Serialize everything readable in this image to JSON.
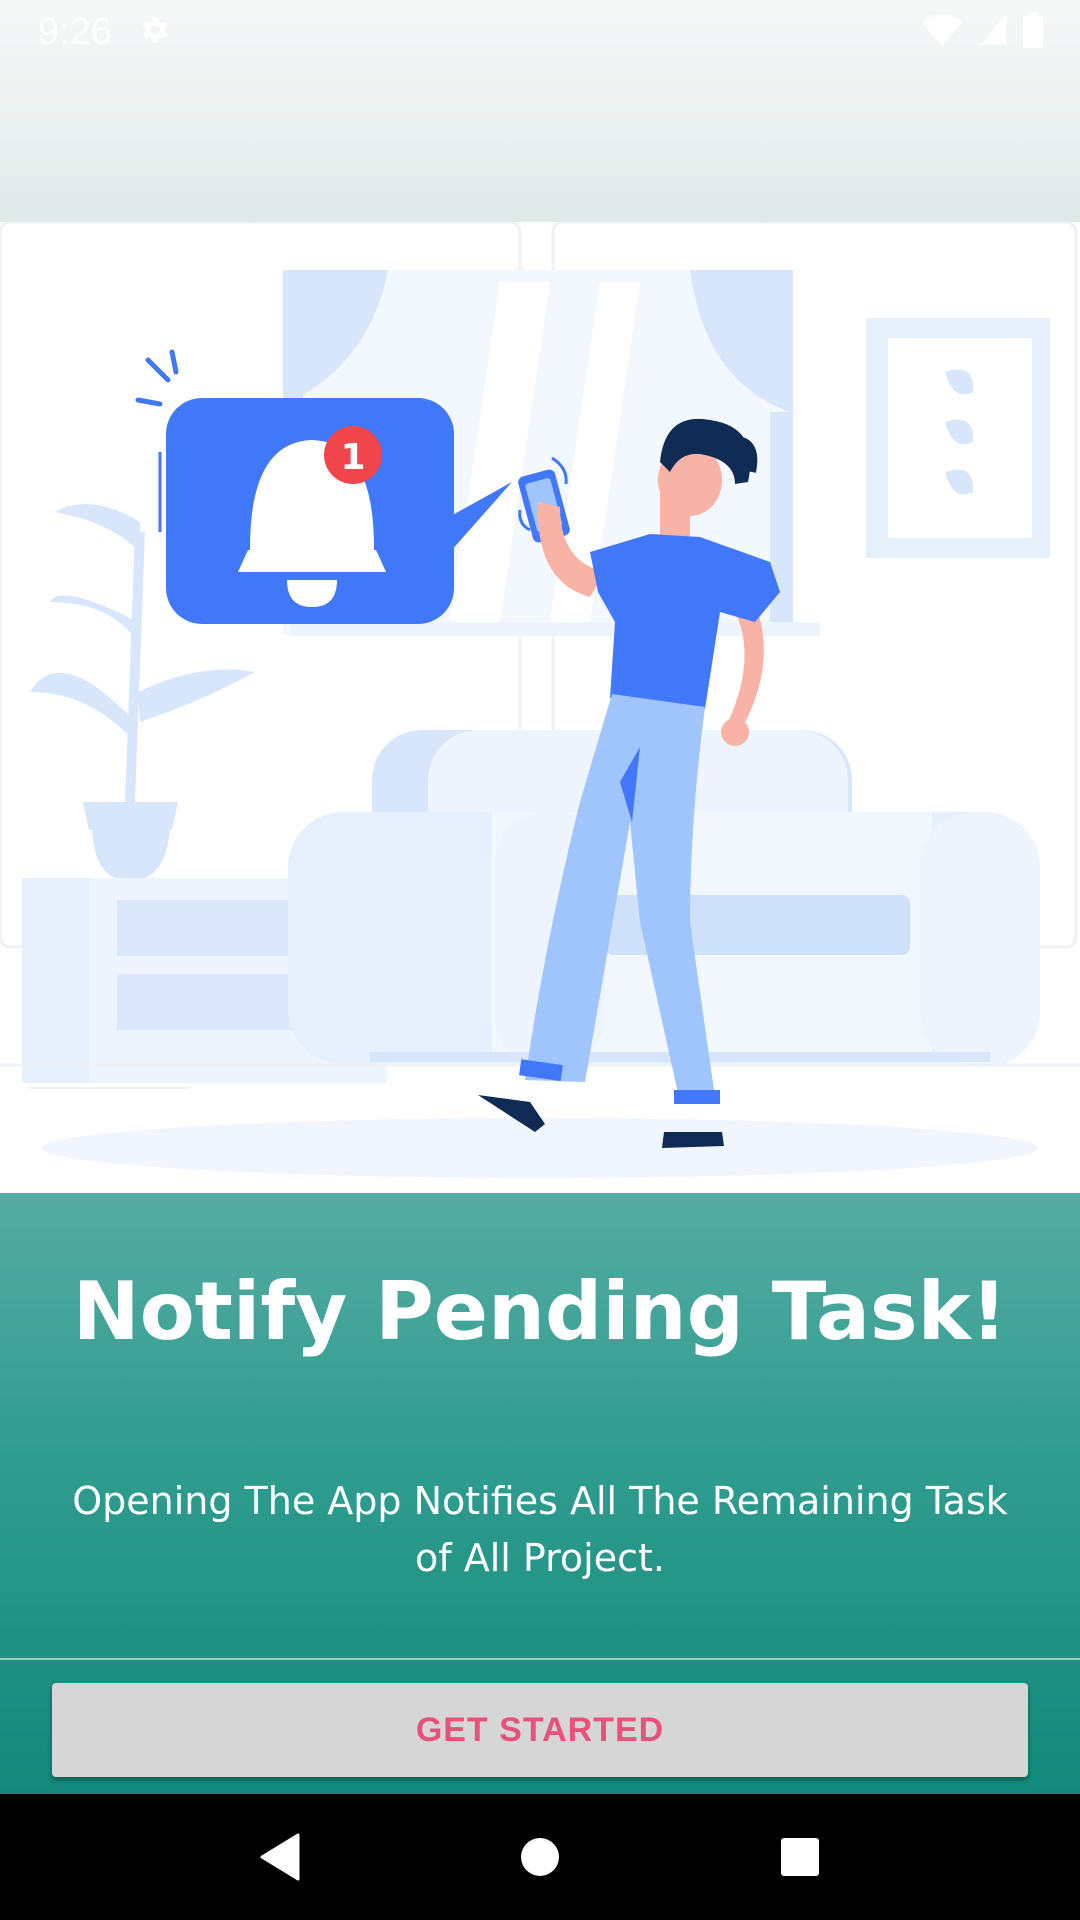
{
  "status_bar": {
    "time": "9:26",
    "icons": [
      "settings-gear-icon",
      "wifi-icon",
      "cell-signal-icon",
      "battery-icon"
    ]
  },
  "onboarding": {
    "title": "Notify Pending Task!",
    "description": "Opening The App Notifies All The Remaining Task of All Project.",
    "notification_badge_count": "1",
    "button_label": "GET STARTED"
  },
  "nav_bar": {
    "icons": [
      "back-triangle-icon",
      "home-circle-icon",
      "recents-square-icon"
    ]
  },
  "colors": {
    "panel_gradient_top": "#56aba2",
    "panel_gradient_bottom": "#12897a",
    "button_background": "#d6d6d6",
    "button_text": "#e8527a",
    "illustration_blue": "#4178fa",
    "illustration_light_blue": "#a0c4fc",
    "badge_red": "#f0454a"
  }
}
